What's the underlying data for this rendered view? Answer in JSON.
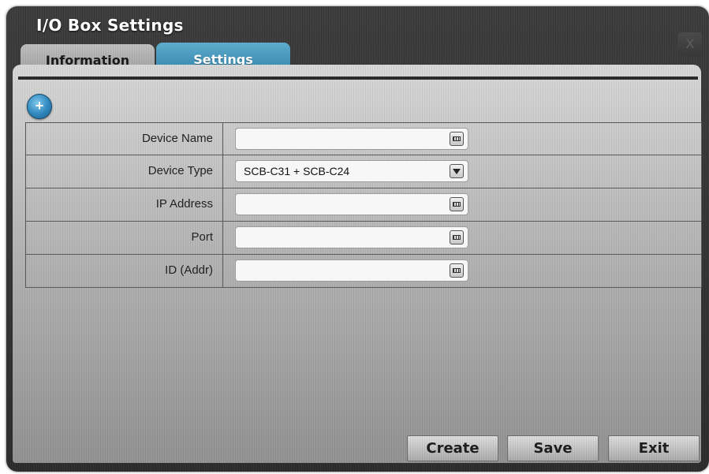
{
  "window": {
    "title": "I/O Box Settings",
    "close_glyph": "X"
  },
  "tabs": [
    {
      "label": "Information",
      "active": false
    },
    {
      "label": "Settings",
      "active": true
    }
  ],
  "toolbar": {
    "add_glyph": "+"
  },
  "form": {
    "rows": [
      {
        "label": "Device Name",
        "value": "",
        "control": "text",
        "icon": "keyboard-icon"
      },
      {
        "label": "Device Type",
        "value": "SCB-C31 + SCB-C24",
        "control": "select",
        "icon": "dropdown-arrow-icon"
      },
      {
        "label": "IP Address",
        "value": "",
        "control": "text",
        "icon": "keyboard-icon"
      },
      {
        "label": "Port",
        "value": "",
        "control": "text",
        "icon": "keyboard-icon"
      },
      {
        "label": "ID (Addr)",
        "value": "",
        "control": "text",
        "icon": "keyboard-icon"
      }
    ]
  },
  "buttons": {
    "create": "Create",
    "save": "Save",
    "exit": "Exit"
  },
  "colors": {
    "accent": "#2d7fa6",
    "panel": "#b3b3b3",
    "window": "#2a2a2a"
  }
}
